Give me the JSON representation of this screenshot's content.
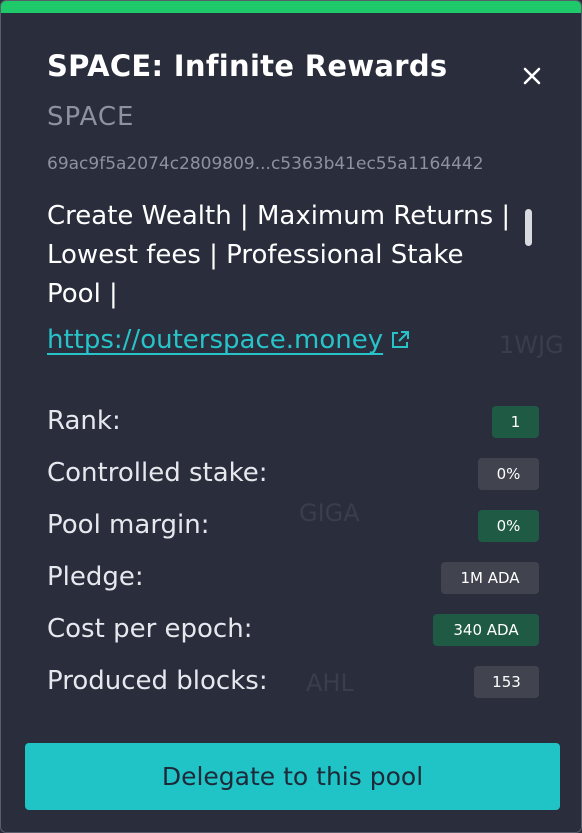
{
  "pool": {
    "title": "SPACE: Infinite Rewards",
    "ticker": "SPACE",
    "id": "69ac9f5a2074c2809809...c5363b41ec55a1164442",
    "description": "Create Wealth | Maximum Returns | Lowest fees | Professional Stake Pool |",
    "link": "https://outerspace.money"
  },
  "stats": [
    {
      "label": "Rank:",
      "value": "1",
      "style": "green"
    },
    {
      "label": "Controlled stake:",
      "value": "0%",
      "style": "gray"
    },
    {
      "label": "Pool margin:",
      "value": "0%",
      "style": "green"
    },
    {
      "label": "Pledge:",
      "value": "1M ADA",
      "style": "gray"
    },
    {
      "label": "Cost per epoch:",
      "value": "340 ADA",
      "style": "green"
    },
    {
      "label": "Produced blocks:",
      "value": "153",
      "style": "gray"
    }
  ],
  "background": {
    "tile_1_ticker": "1WJG",
    "tile_2_ticker": "GIGA",
    "tile_3_ticker": "AHL"
  },
  "actions": {
    "delegate_label": "Delegate to this pool"
  },
  "colors": {
    "accent": "#21c4c6",
    "progress": "#1ec96a",
    "badge_green": "#1e5a44",
    "badge_gray": "#41444f"
  }
}
